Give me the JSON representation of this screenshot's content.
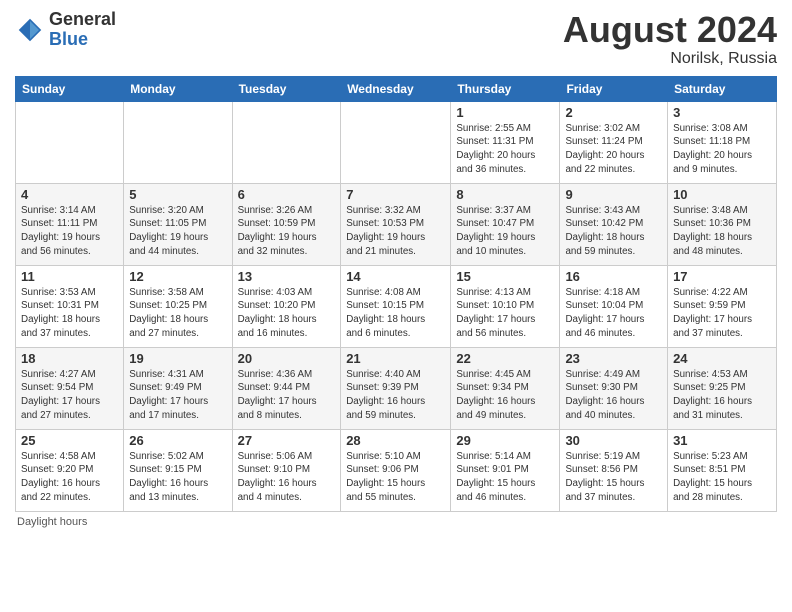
{
  "logo": {
    "general": "General",
    "blue": "Blue"
  },
  "title": "August 2024",
  "location": "Norilsk, Russia",
  "days_of_week": [
    "Sunday",
    "Monday",
    "Tuesday",
    "Wednesday",
    "Thursday",
    "Friday",
    "Saturday"
  ],
  "footer": "Daylight hours",
  "weeks": [
    [
      {
        "date": "",
        "info": ""
      },
      {
        "date": "",
        "info": ""
      },
      {
        "date": "",
        "info": ""
      },
      {
        "date": "",
        "info": ""
      },
      {
        "date": "1",
        "info": "Sunrise: 2:55 AM\nSunset: 11:31 PM\nDaylight: 20 hours\nand 36 minutes."
      },
      {
        "date": "2",
        "info": "Sunrise: 3:02 AM\nSunset: 11:24 PM\nDaylight: 20 hours\nand 22 minutes."
      },
      {
        "date": "3",
        "info": "Sunrise: 3:08 AM\nSunset: 11:18 PM\nDaylight: 20 hours\nand 9 minutes."
      }
    ],
    [
      {
        "date": "4",
        "info": "Sunrise: 3:14 AM\nSunset: 11:11 PM\nDaylight: 19 hours\nand 56 minutes."
      },
      {
        "date": "5",
        "info": "Sunrise: 3:20 AM\nSunset: 11:05 PM\nDaylight: 19 hours\nand 44 minutes."
      },
      {
        "date": "6",
        "info": "Sunrise: 3:26 AM\nSunset: 10:59 PM\nDaylight: 19 hours\nand 32 minutes."
      },
      {
        "date": "7",
        "info": "Sunrise: 3:32 AM\nSunset: 10:53 PM\nDaylight: 19 hours\nand 21 minutes."
      },
      {
        "date": "8",
        "info": "Sunrise: 3:37 AM\nSunset: 10:47 PM\nDaylight: 19 hours\nand 10 minutes."
      },
      {
        "date": "9",
        "info": "Sunrise: 3:43 AM\nSunset: 10:42 PM\nDaylight: 18 hours\nand 59 minutes."
      },
      {
        "date": "10",
        "info": "Sunrise: 3:48 AM\nSunset: 10:36 PM\nDaylight: 18 hours\nand 48 minutes."
      }
    ],
    [
      {
        "date": "11",
        "info": "Sunrise: 3:53 AM\nSunset: 10:31 PM\nDaylight: 18 hours\nand 37 minutes."
      },
      {
        "date": "12",
        "info": "Sunrise: 3:58 AM\nSunset: 10:25 PM\nDaylight: 18 hours\nand 27 minutes."
      },
      {
        "date": "13",
        "info": "Sunrise: 4:03 AM\nSunset: 10:20 PM\nDaylight: 18 hours\nand 16 minutes."
      },
      {
        "date": "14",
        "info": "Sunrise: 4:08 AM\nSunset: 10:15 PM\nDaylight: 18 hours\nand 6 minutes."
      },
      {
        "date": "15",
        "info": "Sunrise: 4:13 AM\nSunset: 10:10 PM\nDaylight: 17 hours\nand 56 minutes."
      },
      {
        "date": "16",
        "info": "Sunrise: 4:18 AM\nSunset: 10:04 PM\nDaylight: 17 hours\nand 46 minutes."
      },
      {
        "date": "17",
        "info": "Sunrise: 4:22 AM\nSunset: 9:59 PM\nDaylight: 17 hours\nand 37 minutes."
      }
    ],
    [
      {
        "date": "18",
        "info": "Sunrise: 4:27 AM\nSunset: 9:54 PM\nDaylight: 17 hours\nand 27 minutes."
      },
      {
        "date": "19",
        "info": "Sunrise: 4:31 AM\nSunset: 9:49 PM\nDaylight: 17 hours\nand 17 minutes."
      },
      {
        "date": "20",
        "info": "Sunrise: 4:36 AM\nSunset: 9:44 PM\nDaylight: 17 hours\nand 8 minutes."
      },
      {
        "date": "21",
        "info": "Sunrise: 4:40 AM\nSunset: 9:39 PM\nDaylight: 16 hours\nand 59 minutes."
      },
      {
        "date": "22",
        "info": "Sunrise: 4:45 AM\nSunset: 9:34 PM\nDaylight: 16 hours\nand 49 minutes."
      },
      {
        "date": "23",
        "info": "Sunrise: 4:49 AM\nSunset: 9:30 PM\nDaylight: 16 hours\nand 40 minutes."
      },
      {
        "date": "24",
        "info": "Sunrise: 4:53 AM\nSunset: 9:25 PM\nDaylight: 16 hours\nand 31 minutes."
      }
    ],
    [
      {
        "date": "25",
        "info": "Sunrise: 4:58 AM\nSunset: 9:20 PM\nDaylight: 16 hours\nand 22 minutes."
      },
      {
        "date": "26",
        "info": "Sunrise: 5:02 AM\nSunset: 9:15 PM\nDaylight: 16 hours\nand 13 minutes."
      },
      {
        "date": "27",
        "info": "Sunrise: 5:06 AM\nSunset: 9:10 PM\nDaylight: 16 hours\nand 4 minutes."
      },
      {
        "date": "28",
        "info": "Sunrise: 5:10 AM\nSunset: 9:06 PM\nDaylight: 15 hours\nand 55 minutes."
      },
      {
        "date": "29",
        "info": "Sunrise: 5:14 AM\nSunset: 9:01 PM\nDaylight: 15 hours\nand 46 minutes."
      },
      {
        "date": "30",
        "info": "Sunrise: 5:19 AM\nSunset: 8:56 PM\nDaylight: 15 hours\nand 37 minutes."
      },
      {
        "date": "31",
        "info": "Sunrise: 5:23 AM\nSunset: 8:51 PM\nDaylight: 15 hours\nand 28 minutes."
      }
    ]
  ]
}
